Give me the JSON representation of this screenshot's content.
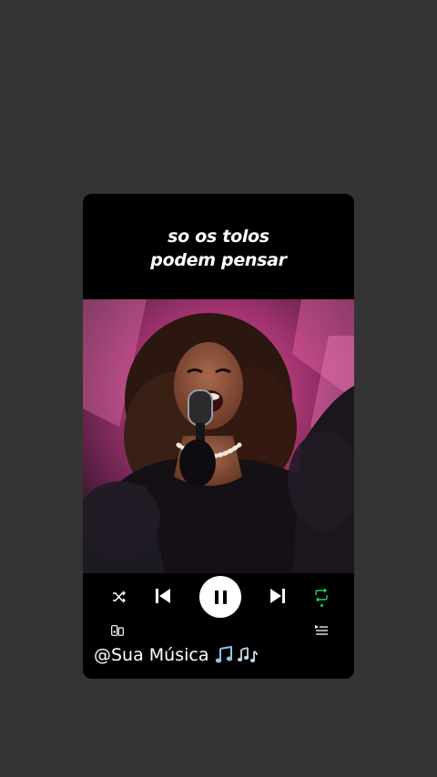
{
  "lyrics": {
    "line1": "so os tolos",
    "line2": "podem pensar"
  },
  "caption": {
    "handle": "@Sua Música"
  },
  "player": {
    "state": "playing",
    "shuffle_icon": "shuffle-icon",
    "prev_icon": "skip-previous-icon",
    "pause_icon": "pause-icon",
    "next_icon": "skip-next-icon",
    "repeat_icon": "repeat-icon",
    "device_icon": "connect-device-icon",
    "queue_icon": "queue-icon",
    "repeat_color": "#1ed760"
  },
  "colors": {
    "page_bg": "#343434",
    "card_bg": "#000000",
    "stage_pink": "#d04a8c"
  }
}
